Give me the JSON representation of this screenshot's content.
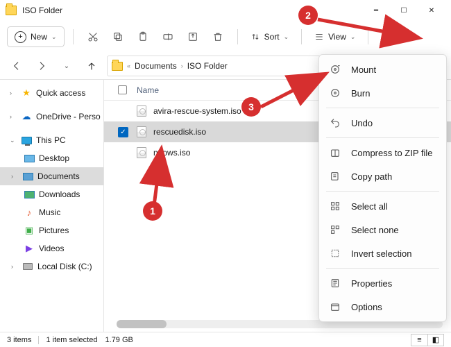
{
  "window": {
    "title": "ISO Folder"
  },
  "toolbar": {
    "new_label": "New",
    "sort_label": "Sort",
    "view_label": "View"
  },
  "breadcrumb": {
    "level1": "Documents",
    "level2": "ISO Folder"
  },
  "columns": {
    "name": "Name"
  },
  "sidebar": {
    "quick_access": "Quick access",
    "onedrive": "OneDrive - Perso",
    "this_pc": "This PC",
    "desktop": "Desktop",
    "documents": "Documents",
    "downloads": "Downloads",
    "music": "Music",
    "pictures": "Pictures",
    "videos": "Videos",
    "local_disk": "Local Disk (C:)"
  },
  "files": [
    {
      "name": "avira-rescue-system.iso",
      "selected": false
    },
    {
      "name": "rescuedisk.iso",
      "selected": true
    },
    {
      "name": "ndows.iso",
      "selected": false
    }
  ],
  "context_menu": {
    "mount": "Mount",
    "burn": "Burn",
    "undo": "Undo",
    "compress": "Compress to ZIP file",
    "copy_path": "Copy path",
    "select_all": "Select all",
    "select_none": "Select none",
    "invert_selection": "Invert selection",
    "properties": "Properties",
    "options": "Options"
  },
  "status": {
    "items": "3 items",
    "selected": "1 item selected",
    "size": "1.79 GB"
  },
  "annotations": {
    "b1": "1",
    "b2": "2",
    "b3": "3"
  }
}
